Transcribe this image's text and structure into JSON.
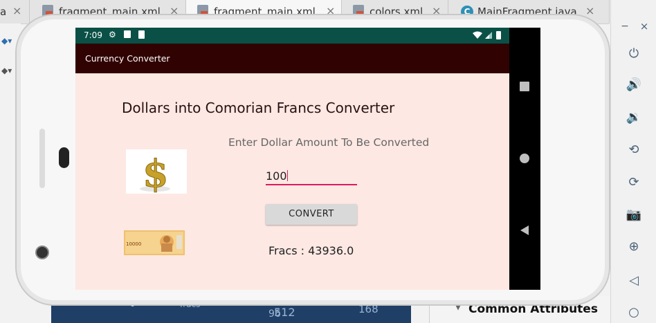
{
  "ide": {
    "tabs": [
      {
        "label": "a",
        "type": "partial"
      },
      {
        "label": "fragment_main.xml",
        "type": "layout"
      },
      {
        "label": "fragment_main.xml",
        "type": "layout"
      },
      {
        "label": "colors.xml",
        "type": "values"
      },
      {
        "label": "MainFragment.java",
        "type": "class",
        "icon_letter": "C"
      }
    ],
    "close_glyph": "×",
    "bottom_panel": {
      "imageview_label": "ImageView",
      "fracs_label": "fracs",
      "numbers": [
        "512",
        "96",
        "168"
      ]
    },
    "attributes_header": "Common Attributes"
  },
  "emulator": {
    "window_controls": {
      "minimize": "−",
      "close": "×"
    }
  },
  "phone": {
    "status": {
      "time": "7:09"
    },
    "app_title": "Currency Converter",
    "heading": "Dollars into Comorian Francs Converter",
    "hint": "Enter Dollar Amount To Be Converted",
    "input_value": "100",
    "convert_label": "CONVERT",
    "result_text": "Fracs : 43936.0",
    "banknote_value": "10000",
    "colors": {
      "status_bar": "#0b5046",
      "app_bar": "#310202",
      "content_bg": "#fde8e3",
      "accent": "#d81b60"
    }
  }
}
